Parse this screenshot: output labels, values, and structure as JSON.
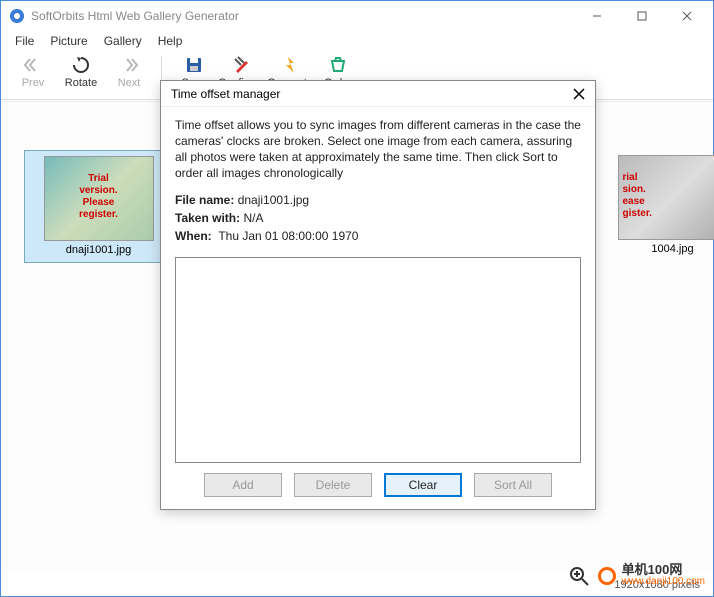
{
  "window": {
    "title": "SoftOrbits Html Web Gallery Generator"
  },
  "menu": {
    "file": "File",
    "picture": "Picture",
    "gallery": "Gallery",
    "help": "Help"
  },
  "toolbar": {
    "prev": "Prev",
    "rotate": "Rotate",
    "next": "Next",
    "save": "Save",
    "configure": "Configure",
    "generate": "Generate",
    "order": "Order"
  },
  "thumbnails": [
    {
      "filename": "dnaji1001.jpg",
      "watermark": "Trial\nversion.\nPlease\nregister."
    },
    {
      "filename": "1004.jpg",
      "watermark": "rial\nsion.\nease\ngister."
    }
  ],
  "dialog": {
    "title": "Time offset manager",
    "description": "Time offset allows you to sync images from different cameras in the case the cameras' clocks are broken. Select one image from each camera, assuring all photos were taken at approximately the same time. Then click Sort to order all images chronologically",
    "file_name_label": "File name:",
    "file_name_value": "dnaji1001.jpg",
    "taken_with_label": "Taken with:",
    "taken_with_value": "N/A",
    "when_label": "When:",
    "when_value": "Thu Jan 01 08:00:00 1970",
    "buttons": {
      "add": "Add",
      "delete": "Delete",
      "clear": "Clear",
      "sort_all": "Sort All"
    }
  },
  "statusbar": {
    "dimensions": "1920x1080 pixels"
  },
  "site_watermark": {
    "line1": "单机100网",
    "line2": "www.danji100.com"
  }
}
